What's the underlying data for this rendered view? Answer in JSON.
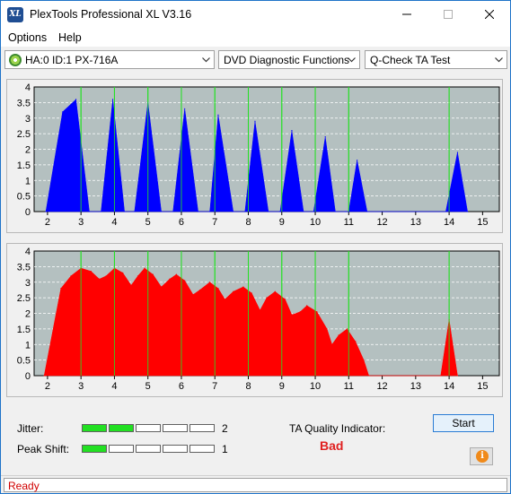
{
  "window": {
    "title": "PlexTools Professional XL V3.16",
    "icon_label": "XL"
  },
  "menu": {
    "items": [
      "Options",
      "Help"
    ]
  },
  "toolbar": {
    "drive": "HA:0 ID:1  PX-716A",
    "function": "DVD Diagnostic Functions",
    "test": "Q-Check TA Test"
  },
  "chart_data": [
    {
      "type": "bar",
      "color": "#0000ff",
      "x_ticks": [
        2,
        3,
        4,
        5,
        6,
        7,
        8,
        9,
        10,
        11,
        12,
        13,
        14,
        15
      ],
      "y_ticks": [
        "4",
        "3.5",
        "3",
        "2.5",
        "2",
        "1.5",
        "1",
        "0.5",
        "0"
      ],
      "xlim": [
        1.6,
        15.5
      ],
      "ylim": [
        0,
        4
      ],
      "highlight_lines": [
        3,
        4,
        5,
        6,
        7,
        8,
        9,
        10,
        11,
        14
      ],
      "series": [
        {
          "x": [
            1.95,
            2.45,
            2.85,
            3.25,
            3.6,
            3.95,
            4.3,
            4.6,
            5.0,
            5.4,
            5.75,
            6.1,
            6.5,
            6.85,
            7.1,
            7.55,
            7.9,
            8.2,
            8.6,
            8.95,
            9.3,
            9.65,
            9.95,
            10.3,
            10.6,
            10.9,
            11.0,
            11.25,
            11.55,
            13.9,
            14.25,
            14.55
          ],
          "y": [
            0,
            3.2,
            3.6,
            0,
            0,
            3.6,
            0,
            0,
            3.5,
            0,
            0,
            3.3,
            0,
            0,
            3.1,
            0,
            0,
            2.9,
            0,
            0,
            2.6,
            0,
            0,
            2.4,
            0,
            0,
            0,
            1.65,
            0,
            0,
            1.9,
            0
          ]
        }
      ]
    },
    {
      "type": "bar",
      "color": "#ff0000",
      "x_ticks": [
        2,
        3,
        4,
        5,
        6,
        7,
        8,
        9,
        10,
        11,
        12,
        13,
        14,
        15
      ],
      "y_ticks": [
        "4",
        "3.5",
        "3",
        "2.5",
        "2",
        "1.5",
        "1",
        "0.5",
        "0"
      ],
      "xlim": [
        1.6,
        15.5
      ],
      "ylim": [
        0,
        4
      ],
      "highlight_lines": [
        3,
        4,
        5,
        6,
        7,
        8,
        9,
        10,
        11,
        14
      ],
      "series": [
        {
          "x": [
            1.9,
            2.4,
            2.7,
            3.0,
            3.3,
            3.55,
            3.75,
            4.0,
            4.25,
            4.5,
            4.7,
            4.9,
            5.15,
            5.4,
            5.65,
            5.85,
            6.1,
            6.35,
            6.55,
            6.85,
            7.1,
            7.3,
            7.55,
            7.85,
            8.1,
            8.35,
            8.55,
            8.8,
            9.1,
            9.3,
            9.55,
            9.75,
            10.05,
            10.35,
            10.5,
            10.7,
            10.95,
            11.2,
            11.45,
            11.6,
            13.75,
            14.0,
            14.25
          ],
          "y": [
            0,
            2.8,
            3.2,
            3.45,
            3.35,
            3.1,
            3.2,
            3.45,
            3.3,
            2.9,
            3.2,
            3.45,
            3.25,
            2.85,
            3.1,
            3.25,
            3.05,
            2.6,
            2.75,
            3.0,
            2.8,
            2.45,
            2.7,
            2.85,
            2.65,
            2.1,
            2.5,
            2.7,
            2.45,
            1.95,
            2.05,
            2.25,
            2.05,
            1.5,
            1.0,
            1.3,
            1.5,
            1.1,
            0.5,
            0,
            0,
            1.8,
            0
          ]
        }
      ]
    }
  ],
  "meters": {
    "jitter": {
      "label": "Jitter:",
      "value": "2",
      "segments_on": 2,
      "segments_total": 5
    },
    "peak_shift": {
      "label": "Peak Shift:",
      "value": "1",
      "segments_on": 1,
      "segments_total": 5
    }
  },
  "ta": {
    "label": "TA Quality Indicator:",
    "value": "Bad",
    "value_color": "#e02020"
  },
  "buttons": {
    "start": "Start",
    "info_icon": "info-icon"
  },
  "status": {
    "text": "Ready"
  }
}
